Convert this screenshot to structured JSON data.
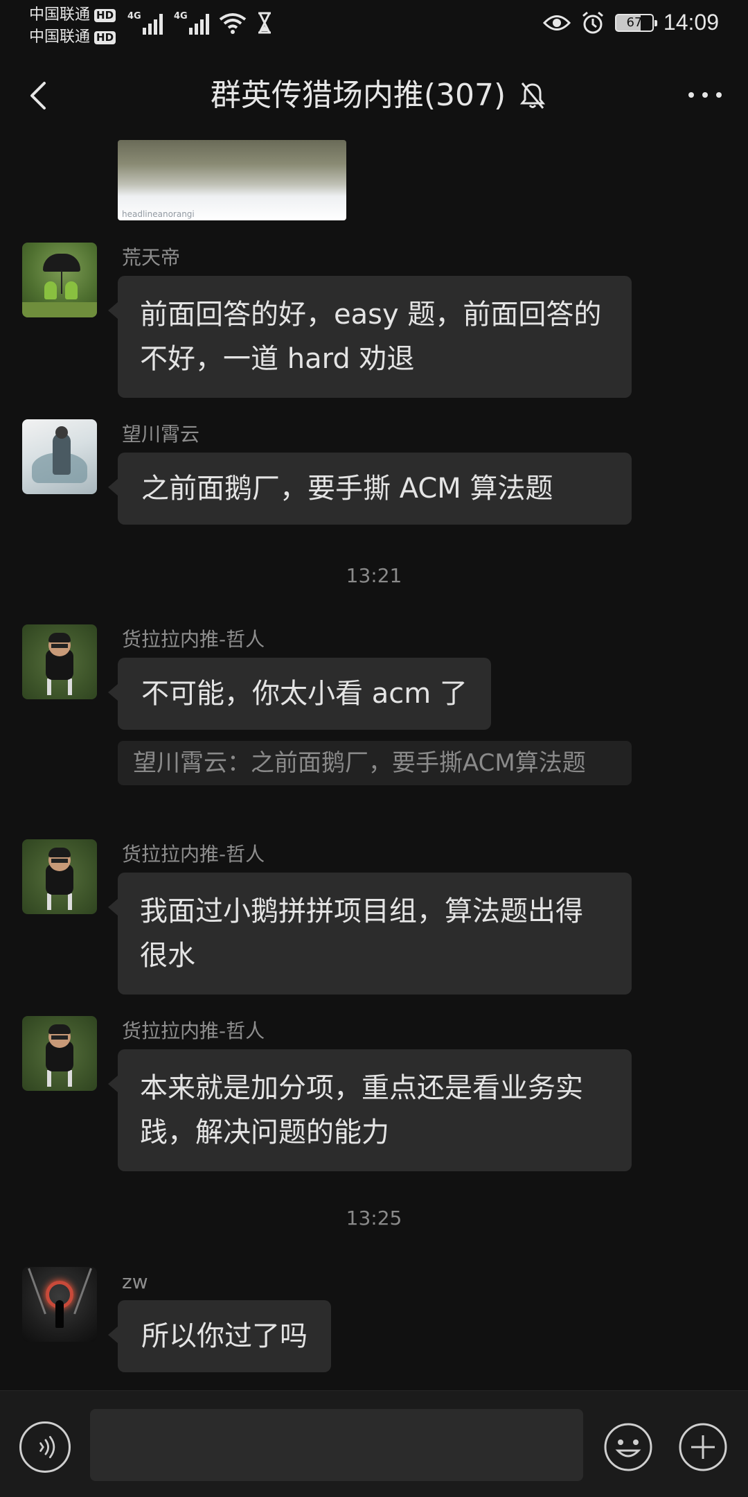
{
  "status_bar": {
    "carrier_1": "中国联通",
    "carrier_2": "中国联通",
    "hd_badge": "HD",
    "network_1": "4G",
    "network_2": "4G",
    "battery": "67",
    "battery_level": 0.67,
    "time": "14:09"
  },
  "header": {
    "title": "群英传猎场内推(307)",
    "back_icon": "chevron-left-icon",
    "mute_icon": "bell-off-icon",
    "more_icon": "more-horizontal-icon"
  },
  "image_message": {
    "watermark": "headlineanorangi"
  },
  "messages": [
    {
      "sender": "荒天帝",
      "text": "前面回答的好，easy 题，前面回答的不好，一道 hard 劝退"
    },
    {
      "sender": "望川霄云",
      "text": "之前面鹅厂，要手撕 ACM 算法题"
    },
    {
      "sender": "货拉拉内推-哲人",
      "text": "不可能，你太小看 acm 了",
      "quote": "望川霄云：之前面鹅厂，要手撕ACM算法题"
    },
    {
      "sender": "货拉拉内推-哲人",
      "text": "我面过小鹅拼拼项目组，算法题出得很水"
    },
    {
      "sender": "货拉拉内推-哲人",
      "text": "本来就是加分项，重点还是看业务实践，解决问题的能力"
    },
    {
      "sender": "zw",
      "text": "所以你过了吗"
    }
  ],
  "timestamps": [
    "13:21",
    "13:25"
  ],
  "input_bar": {
    "voice_icon": "voice-icon",
    "emoji_icon": "smiley-icon",
    "plus_icon": "plus-circle-icon",
    "input_value": ""
  },
  "colors": {
    "background": "#111111",
    "bubble": "#2c2c2c",
    "text": "#e4e4e4",
    "secondary_text": "#8e8e8e"
  }
}
